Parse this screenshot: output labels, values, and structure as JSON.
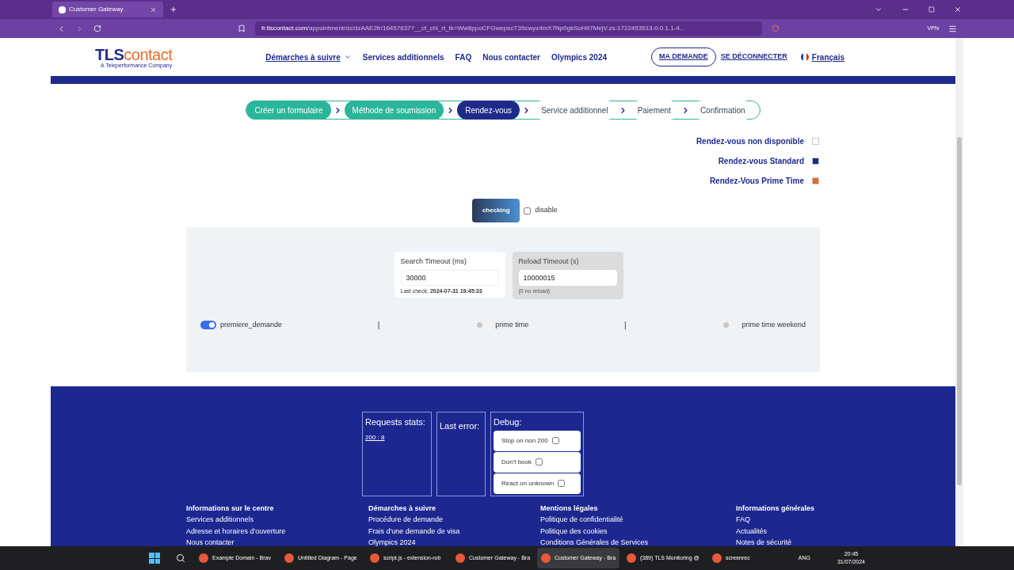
{
  "browser": {
    "tabs": [
      {
        "title": "Customer Gateway",
        "selected": true
      }
    ],
    "url_host": "fr.tlscontact.com",
    "url_path": "/appointment/dz/dzAAE2fr/16457637?__cf_chl_rt_tk=Ww8ppoCFGwepecT39cwyz4mX7Np0gkSoHIt7MejV.zs-1722453513-0.0.1.1-4...",
    "vpn": "VPN"
  },
  "header": {
    "logo_main": "TLS",
    "logo_accent": "contact",
    "logo_sub": "A Teleperformance Company",
    "nav": [
      "Démarches à suivre",
      "Services additionnels",
      "FAQ",
      "Nous contacter",
      "Olympics 2024"
    ],
    "my_request": "MA DEMANDE",
    "logout": "SE DÉCONNECTER",
    "language": "Français"
  },
  "steps": [
    {
      "label": "Créer un formulaire",
      "completed": true,
      "selected": false
    },
    {
      "label": "Méthode de soumission",
      "completed": true,
      "selected": false
    },
    {
      "label": "Rendez-vous",
      "completed": false,
      "selected": true
    },
    {
      "label": "Service additionnel",
      "completed": false,
      "selected": false
    },
    {
      "label": "Paiement",
      "completed": false,
      "selected": false
    },
    {
      "label": "Confirmation",
      "completed": false,
      "selected": false
    }
  ],
  "legend": [
    {
      "label": "Rendez-vous non disponible",
      "color": "#ffffff"
    },
    {
      "label": "Rendez-vous Standard",
      "color": "#1e2a8a"
    },
    {
      "label": "Rendez-Vous Prime Time",
      "color": "#e8692a"
    }
  ],
  "checking_button": "checking",
  "disable": {
    "label": "disable",
    "checked": false
  },
  "search_timeout": {
    "label": "Search Timeout (ms)",
    "value": "30000",
    "note_label": "Last check:",
    "note_value": "2024-07-31 19:45:33"
  },
  "reload_timeout": {
    "label": "Reload Timeout (s)",
    "value": "10000015",
    "note": "(0 no reload)"
  },
  "toggles": [
    {
      "label": "premiere_demande",
      "on": true
    },
    {
      "label": "prime time",
      "on": false
    },
    {
      "label": "prime time weekend",
      "on": false
    }
  ],
  "separators": [
    "|",
    "|"
  ],
  "stats": {
    "title": "Requests stats:",
    "link": "200 : 8"
  },
  "last_error": {
    "title": "Last error:"
  },
  "debug": {
    "title": "Debug:",
    "options": [
      {
        "label": "Stop on non 200",
        "checked": false
      },
      {
        "label": "Don't book",
        "checked": false
      },
      {
        "label": "React on unknown",
        "checked": false
      }
    ]
  },
  "footer": [
    {
      "title": "Informations sur le centre",
      "links": [
        "Services additionnels",
        "Adresse et horaires d'ouverture",
        "Nous contacter"
      ]
    },
    {
      "title": "Démarches à suivre",
      "links": [
        "Procédure de demande",
        "Frais d'une demande de visa",
        "Olympics 2024"
      ]
    },
    {
      "title": "Mentions légales",
      "links": [
        "Politique de confidentialité",
        "Politique des cookies",
        "Conditions Générales de Services"
      ]
    },
    {
      "title": "Informations générales",
      "links": [
        "FAQ",
        "Actualités",
        "Notes de sécurité"
      ]
    }
  ],
  "taskbar": {
    "apps": [
      {
        "title": "Example Domain - Brav",
        "selected": false
      },
      {
        "title": "Untitled Diagram - Page",
        "selected": false
      },
      {
        "title": "script.js - extension-rob",
        "selected": false
      },
      {
        "title": "Customer Gateway - Bra",
        "selected": false
      },
      {
        "title": "Customer Gateway - Bra",
        "selected": true
      },
      {
        "title": "(389) TLS Monitoring @",
        "selected": false
      },
      {
        "title": "screenrec",
        "selected": false
      }
    ],
    "lang": "ANG",
    "time": "20:45",
    "date": "31/07/2024"
  }
}
